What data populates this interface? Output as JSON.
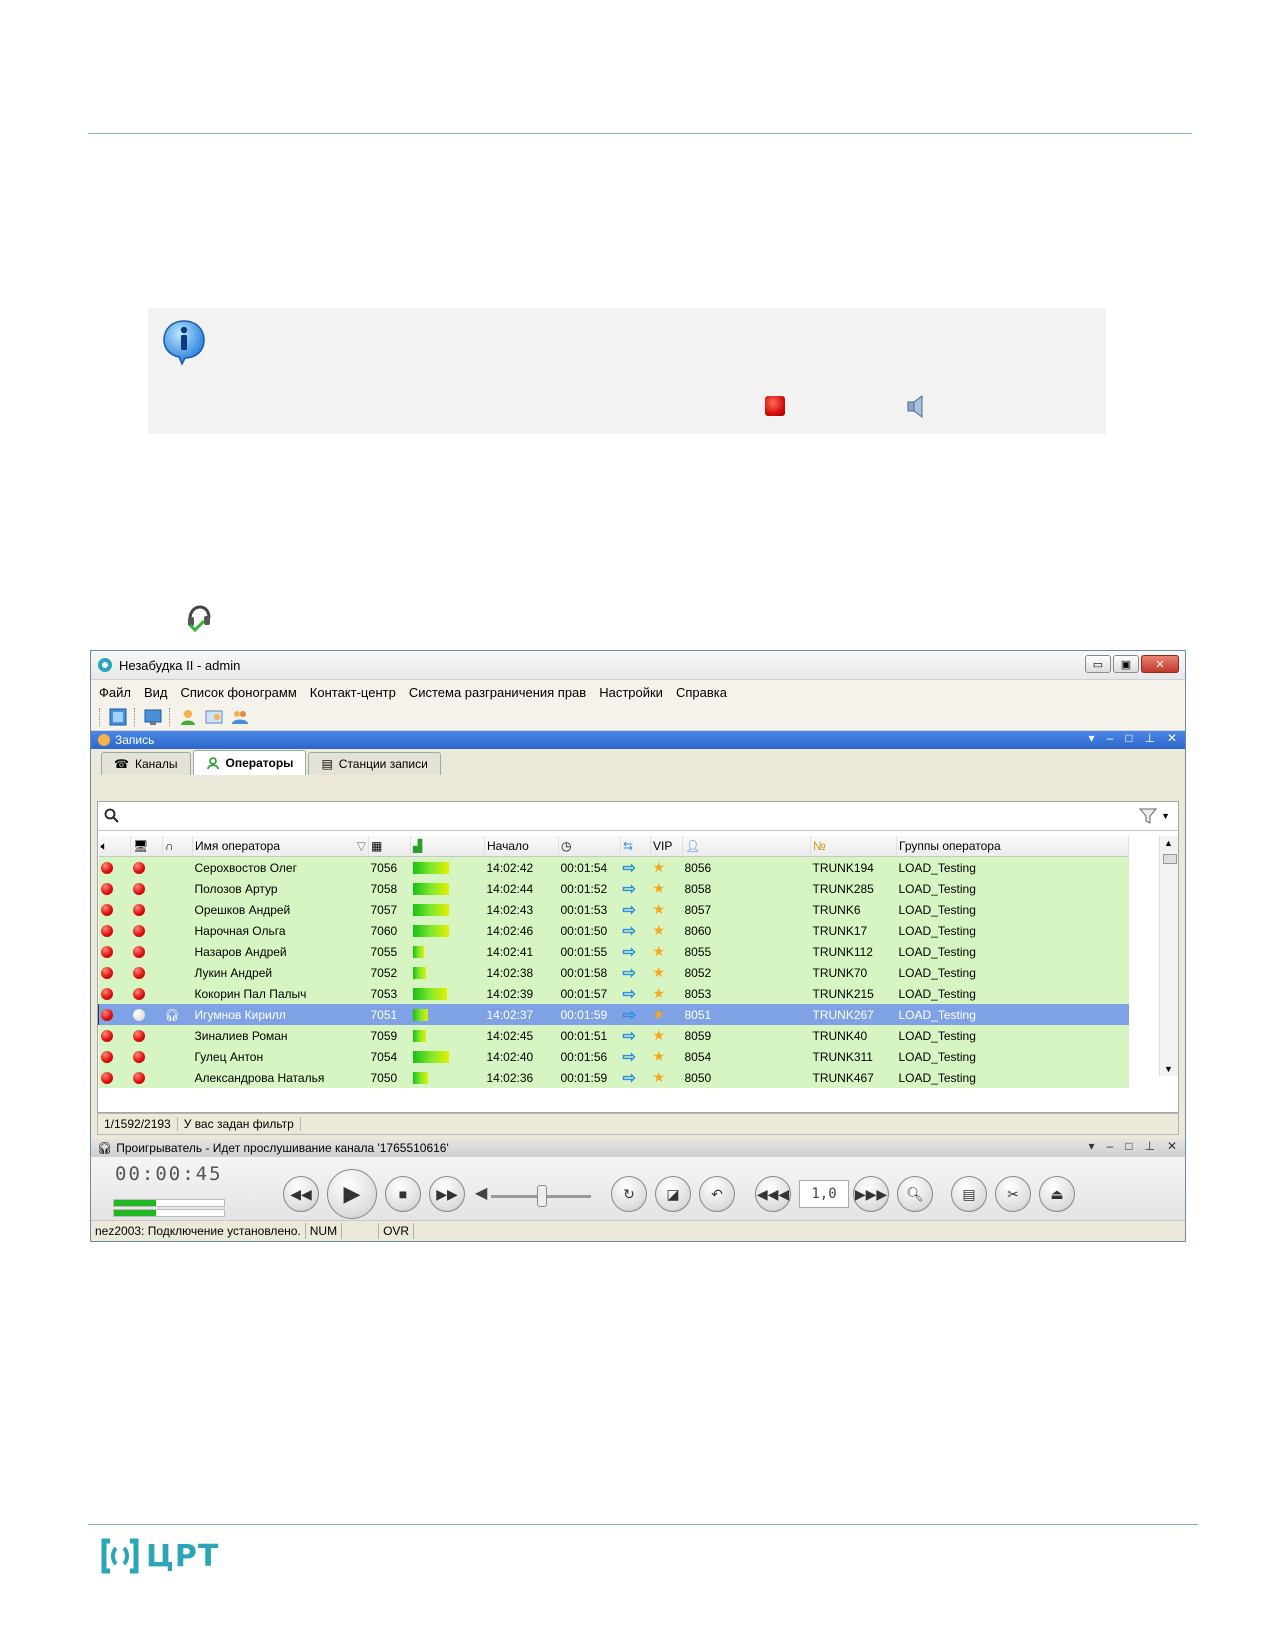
{
  "window": {
    "title": "Незабудка II - admin",
    "min_label": "▭",
    "max_label": "▣",
    "close_label": "✕"
  },
  "menu": [
    "Файл",
    "Вид",
    "Список фонограмм",
    "Контакт-центр",
    "Система разграничения прав",
    "Настройки",
    "Справка"
  ],
  "dock": {
    "title": "Запись"
  },
  "tabs": [
    {
      "label": "Каналы",
      "icon": "phone-icon"
    },
    {
      "label": "Операторы",
      "icon": "operator-icon"
    },
    {
      "label": "Станции записи",
      "icon": "station-icon"
    }
  ],
  "search": {
    "placeholder": ""
  },
  "columns": {
    "name": "Имя оператора",
    "start": "Начало",
    "vip": "VIP",
    "groups": "Группы оператора"
  },
  "rows": [
    {
      "name": "Серохвостов Олег",
      "ext": "7056",
      "level": 0.85,
      "start": "14:02:42",
      "dur": "00:01:54",
      "num": "8056",
      "trunk": "TRUNK194",
      "group": "LOAD_Testing",
      "selected": false
    },
    {
      "name": "Полозов Артур",
      "ext": "7058",
      "level": 0.85,
      "start": "14:02:44",
      "dur": "00:01:52",
      "num": "8058",
      "trunk": "TRUNK285",
      "group": "LOAD_Testing",
      "selected": false
    },
    {
      "name": "Орешков Андрей",
      "ext": "7057",
      "level": 0.85,
      "start": "14:02:43",
      "dur": "00:01:53",
      "num": "8057",
      "trunk": "TRUNK6",
      "group": "LOAD_Testing",
      "selected": false
    },
    {
      "name": "Нарочная Ольга",
      "ext": "7060",
      "level": 0.85,
      "start": "14:02:46",
      "dur": "00:01:50",
      "num": "8060",
      "trunk": "TRUNK17",
      "group": "LOAD_Testing",
      "selected": false
    },
    {
      "name": "Назаров Андрей",
      "ext": "7055",
      "level": 0.25,
      "start": "14:02:41",
      "dur": "00:01:55",
      "num": "8055",
      "trunk": "TRUNK112",
      "group": "LOAD_Testing",
      "selected": false
    },
    {
      "name": "Лукин Андрей",
      "ext": "7052",
      "level": 0.3,
      "start": "14:02:38",
      "dur": "00:01:58",
      "num": "8052",
      "trunk": "TRUNK70",
      "group": "LOAD_Testing",
      "selected": false
    },
    {
      "name": "Кокорин Пал Палыч",
      "ext": "7053",
      "level": 0.8,
      "start": "14:02:39",
      "dur": "00:01:57",
      "num": "8053",
      "trunk": "TRUNK215",
      "group": "LOAD_Testing",
      "selected": false
    },
    {
      "name": "Игумнов Кирилл",
      "ext": "7051",
      "level": 0.35,
      "start": "14:02:37",
      "dur": "00:01:59",
      "num": "8051",
      "trunk": "TRUNK267",
      "group": "LOAD_Testing",
      "selected": true
    },
    {
      "name": "Зиналиев Роман",
      "ext": "7059",
      "level": 0.3,
      "start": "14:02:45",
      "dur": "00:01:51",
      "num": "8059",
      "trunk": "TRUNK40",
      "group": "LOAD_Testing",
      "selected": false
    },
    {
      "name": "Гулец Антон",
      "ext": "7054",
      "level": 0.85,
      "start": "14:02:40",
      "dur": "00:01:56",
      "num": "8054",
      "trunk": "TRUNK311",
      "group": "LOAD_Testing",
      "selected": false
    },
    {
      "name": "Александрова Наталья",
      "ext": "7050",
      "level": 0.35,
      "start": "14:02:36",
      "dur": "00:01:59",
      "num": "8050",
      "trunk": "TRUNK467",
      "group": "LOAD_Testing",
      "selected": false
    }
  ],
  "status": {
    "count": "1/1592/2193",
    "filter": "У вас задан фильтр"
  },
  "player": {
    "title": "Проигрыватель - Идет прослушивание канала '1765510616'",
    "time": "00:00:45",
    "rate": "1,0",
    "volume": 0.5
  },
  "bottom_status": {
    "connection": "nez2003: Подключение установлено.",
    "num": "NUM",
    "blank": "",
    "ovr": "OVR"
  },
  "logo": {
    "text": "ЦРТ"
  },
  "colors": {
    "accent": "#2c67c9",
    "row_bg": "#d7f5c2",
    "selected": "#7fa2e6",
    "logo": "#2aa6b8"
  }
}
